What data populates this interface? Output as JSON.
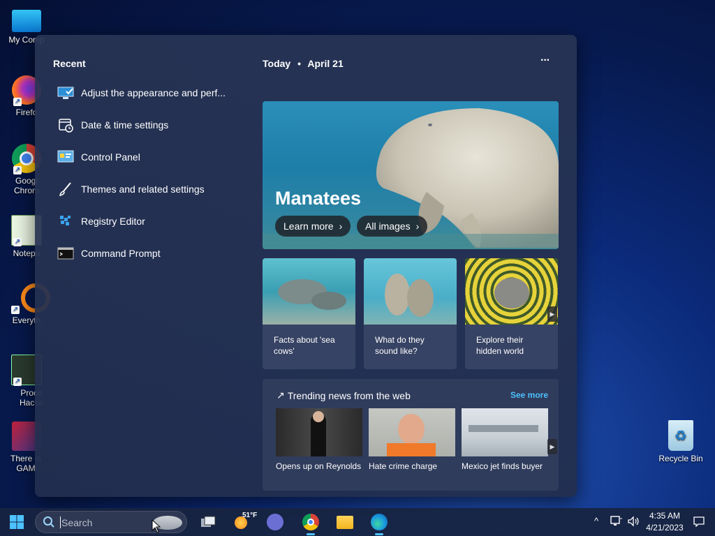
{
  "desktop": {
    "icons": [
      {
        "label": "My Comp"
      },
      {
        "label": "Firefo"
      },
      {
        "label": "Googl Chrom"
      },
      {
        "label": "Notepa"
      },
      {
        "label": "Everyth"
      },
      {
        "label": "Proce Hacke"
      },
      {
        "label": "There Is GAM"
      },
      {
        "label": "Recycle Bin"
      }
    ]
  },
  "recent": {
    "title": "Recent",
    "items": [
      {
        "label": "Adjust the appearance and perf...",
        "icon": "monitor-check-icon"
      },
      {
        "label": "Date & time settings",
        "icon": "calendar-clock-icon"
      },
      {
        "label": "Control Panel",
        "icon": "control-panel-icon"
      },
      {
        "label": "Themes and related settings",
        "icon": "paintbrush-icon"
      },
      {
        "label": "Registry Editor",
        "icon": "registry-icon"
      },
      {
        "label": "Command Prompt",
        "icon": "terminal-icon"
      }
    ]
  },
  "today": {
    "label": "Today",
    "separator": "•",
    "date": "April 21",
    "more": "···"
  },
  "hero": {
    "title": "Manatees",
    "learn_more": "Learn more",
    "all_images": "All images"
  },
  "cards": [
    {
      "caption": "Facts about 'sea cows'"
    },
    {
      "caption": "What do they sound like?"
    },
    {
      "caption": "Explore their hidden world"
    }
  ],
  "trending": {
    "title": "Trending news from the web",
    "see_more": "See more",
    "items": [
      {
        "caption": "Opens up on Reynolds"
      },
      {
        "caption": "Hate crime charge"
      },
      {
        "caption": "Mexico jet finds buyer"
      }
    ]
  },
  "taskbar": {
    "search_placeholder": "Search",
    "weather_temp": "51°F",
    "time": "4:35 AM",
    "date": "4/21/2023"
  },
  "colors": {
    "accent": "#4cc2ff",
    "flyout_bg": "#263253"
  }
}
